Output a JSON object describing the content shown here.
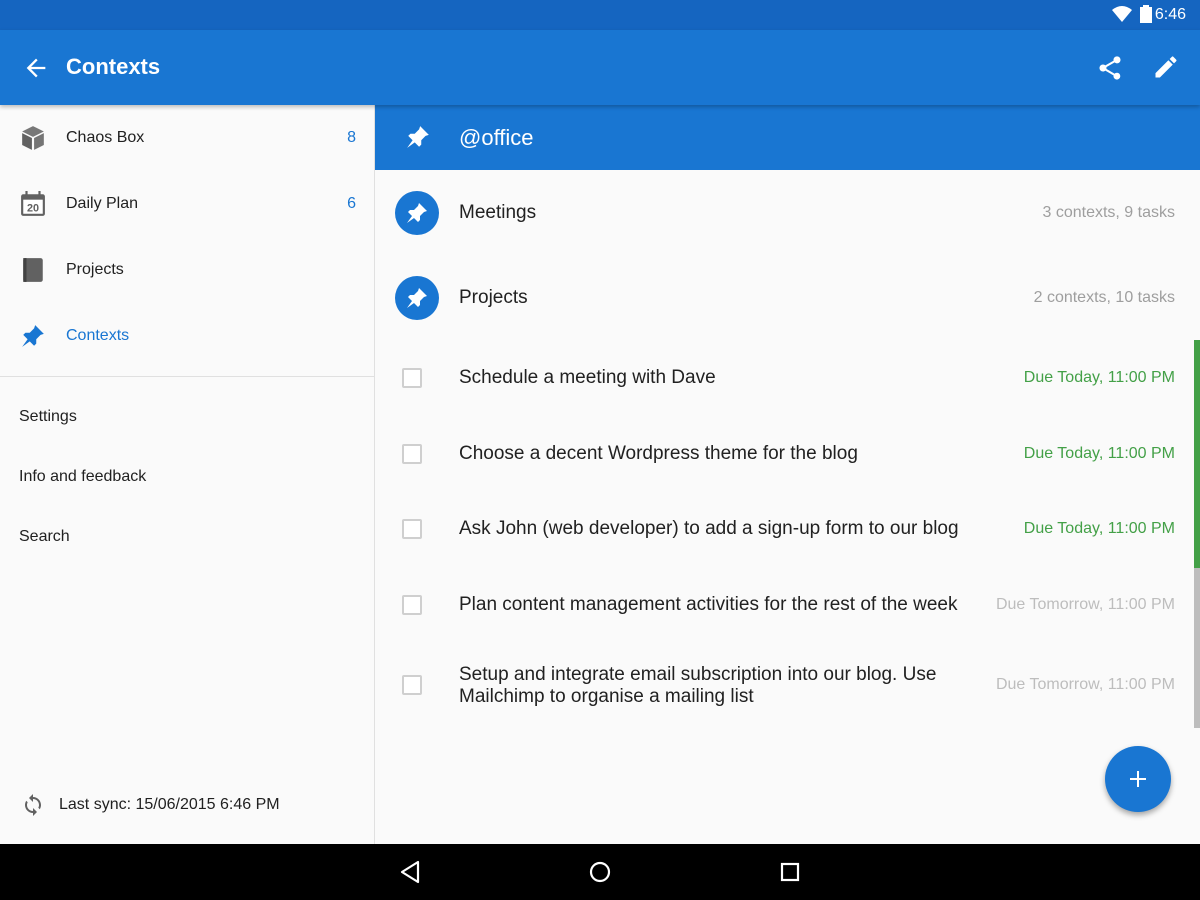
{
  "status_bar": {
    "time": "6:46",
    "wifi_icon": "wifi-icon",
    "battery_icon": "battery-icon"
  },
  "app_bar": {
    "title": "Contexts",
    "back_icon": "arrow-back-icon",
    "share_icon": "share-icon",
    "edit_icon": "pencil-icon",
    "color": "#1976d2"
  },
  "sidebar": {
    "items": [
      {
        "label": "Chaos Box",
        "count": "8",
        "icon": "box-icon"
      },
      {
        "label": "Daily Plan",
        "count": "6",
        "icon": "calendar-icon",
        "calendar_day": "20"
      },
      {
        "label": "Projects",
        "count": "",
        "icon": "notebook-icon"
      },
      {
        "label": "Contexts",
        "count": "",
        "icon": "pin-icon",
        "active": true
      }
    ],
    "links": [
      "Settings",
      "Info and feedback",
      "Search"
    ],
    "sync_text": "Last sync: 15/06/2015 6:46 PM"
  },
  "main": {
    "context_title": "@office",
    "sub_contexts": [
      {
        "title": "Meetings",
        "meta": "3 contexts, 9 tasks"
      },
      {
        "title": "Projects",
        "meta": "2 contexts, 10 tasks"
      }
    ],
    "tasks": [
      {
        "title": "Schedule a meeting with Dave",
        "due": "Due Today, 11:00 PM",
        "status": "today"
      },
      {
        "title": "Choose a decent Wordpress theme for the blog",
        "due": "Due Today, 11:00 PM",
        "status": "today"
      },
      {
        "title": "Ask John (web developer) to add a sign-up form to our blog",
        "due": "Due Today, 11:00 PM",
        "status": "today"
      },
      {
        "title": "Plan content management activities for the rest of the week",
        "due": "Due Tomorrow, 11:00 PM",
        "status": "tomorrow"
      },
      {
        "title": "Setup and integrate email subscription into our blog. Use Mailchimp to organise a mailing list",
        "due": "Due Tomorrow, 11:00 PM",
        "status": "tomorrow"
      }
    ],
    "due_colors": {
      "today": "#43a047",
      "tomorrow": "#bdbdbd"
    },
    "fab_icon": "plus-icon"
  },
  "system_nav": {
    "back": "triangle-back-icon",
    "home": "circle-home-icon",
    "recents": "square-recents-icon"
  }
}
